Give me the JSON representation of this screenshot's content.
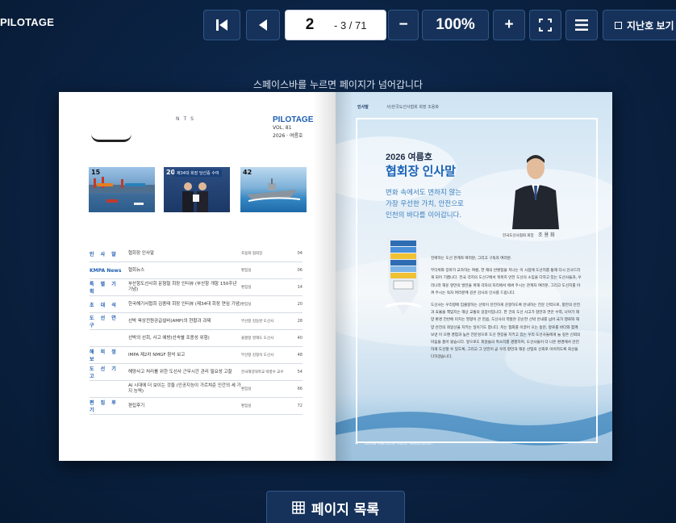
{
  "app": {
    "brand": "PILOTAGE"
  },
  "toolbar": {
    "current_page": "2",
    "page_total": "- 3 / 71",
    "zoom": "100%",
    "archive_label": "지난호 보기"
  },
  "hint": "스페이스바를 누르면 페이지가 넘어갑니다",
  "left_page": {
    "header_nts": "NTS",
    "mast_title": "PILOTAGE",
    "mast_vol": "VOL. 81",
    "mast_issue": "2026 · 여름호",
    "thumbs": [
      {
        "num": "15",
        "caption": ""
      },
      {
        "num": "20",
        "caption": "제34대 회장 당선증 수여"
      },
      {
        "num": "42",
        "caption": ""
      }
    ],
    "toc": [
      {
        "category": "인 사 말",
        "title": "협회장 인사말",
        "author": "조용화 협회장",
        "page": "04"
      },
      {
        "category": "KMPA News",
        "title": "협회뉴스",
        "author": "편집실",
        "page": "06"
      },
      {
        "category": "특 별 기 획",
        "title": "부산항도선사회 문형철 회장 인터뷰 (부산항 개항 150주년 기념)",
        "author": "편집실",
        "page": "14"
      },
      {
        "category": "초 대 석",
        "title": "한국해기사협회 김종태 회장 인터뷰 (제34대 회장 연임 기념)",
        "author": "편집실",
        "page": "20"
      },
      {
        "category": "도 선 연 구",
        "title": "선박 육상전원공급설비(AMP)의 현황과 과제",
        "author": "부산항 김동완 도선사",
        "page": "28"
      },
      {
        "category": "",
        "title": "선박의 선회, 사고 예방(선속별 조종성 위험)",
        "author": "울평항 영해도 도선사",
        "page": "40"
      },
      {
        "category": "해 외 정 보",
        "title": "IMPA 제2차 NMGF 참석 보고",
        "author": "부산항 김형석 도선사",
        "page": "48"
      },
      {
        "category": "도 선 기 고",
        "title": "해양사고 처리를 위한 도선사 근무시간 관리 필요성 고찰",
        "author": "한국해양대학교 박병수 교수",
        "page": "54"
      },
      {
        "category": "",
        "title": "AI 시대에 더 보이는 것들 (인공지능이 가르쳐준 인간의 세 가지 능력)",
        "author": "편집실",
        "page": "66"
      },
      {
        "category": "편 집 후 기",
        "title": "편집후기",
        "author": "편집실",
        "page": "72"
      }
    ]
  },
  "right_page": {
    "header_tag": "인사말",
    "header_desc": "사)한국도선사협회 회장 조용화",
    "issue_line": "2026 여름호",
    "title": "협회장 인사말",
    "calligraphy": [
      "변화 속에서도 변하지 않는",
      "가장 우선한 가치, 안전으로",
      "인천의 바다를 이어갑니다."
    ],
    "person_caption": "한국도선사협회 회장",
    "person_name": "조 용 화",
    "body_paragraphs": [
      "친애하는 도선 관계자 여러분, 그리고 구독자 여러분.",
      "무더위와 장마가 교차하는 여름, 한 해의 반환점을 지나는 이 시점에 도선지를 통해 다시 인사드리게 되어 기쁩니다. 전국 각지의 도선구에서 묵묵히 안전 도선의 소임을 다하고 있는 도선사들과, 우리나라 해운 항만의 발전을 위해 각자의 자리에서 애써 주시는 관계자 여러분, 그리고 도선지를 아껴 주시는 독자 여러분께 깊은 감사의 인사를 드립니다.",
      "도선사는 우리항에 입출항하는 선박이 안전하게 운항하도록 안내하는 전문 인력으로, 항만의 안전과 효율을 책임지는 해상 교통의 길잡이입니다. 한 건의 도선 사고가 항만과 연안 수역, 나아가 해양 환경 전반에 미치는 영향이 큰 만큼, 도선사의 역할은 단순한 선박 안내를 넘어 국가 행로와 해양 안전의 최일선을 지키는 일이기도 합니다. 저는 협회를 이끌어 오는 동안, 항로를 바다와 함께 보낸 이 오랜 경험과 높은 전문성으로 도선 현장을 지키고 있는 우리 도선사들에게 늘 깊은 신뢰의 마음을 품어 왔습니다. 앞으로도 회원들의 목소리를 경청하며, 도선사들이 더 나은 환경에서 안전하게 도선할 수 있도록, 그리고 그 안전이 곧 우리 항만과 해운 산업의 신뢰로 이어지도록 최선을 다하겠습니다."
    ],
    "footer_page": "4",
    "footer_assoc": "Korea Maritime Pilots' Association"
  },
  "bottom": {
    "toc_button": "페이지 목록"
  }
}
